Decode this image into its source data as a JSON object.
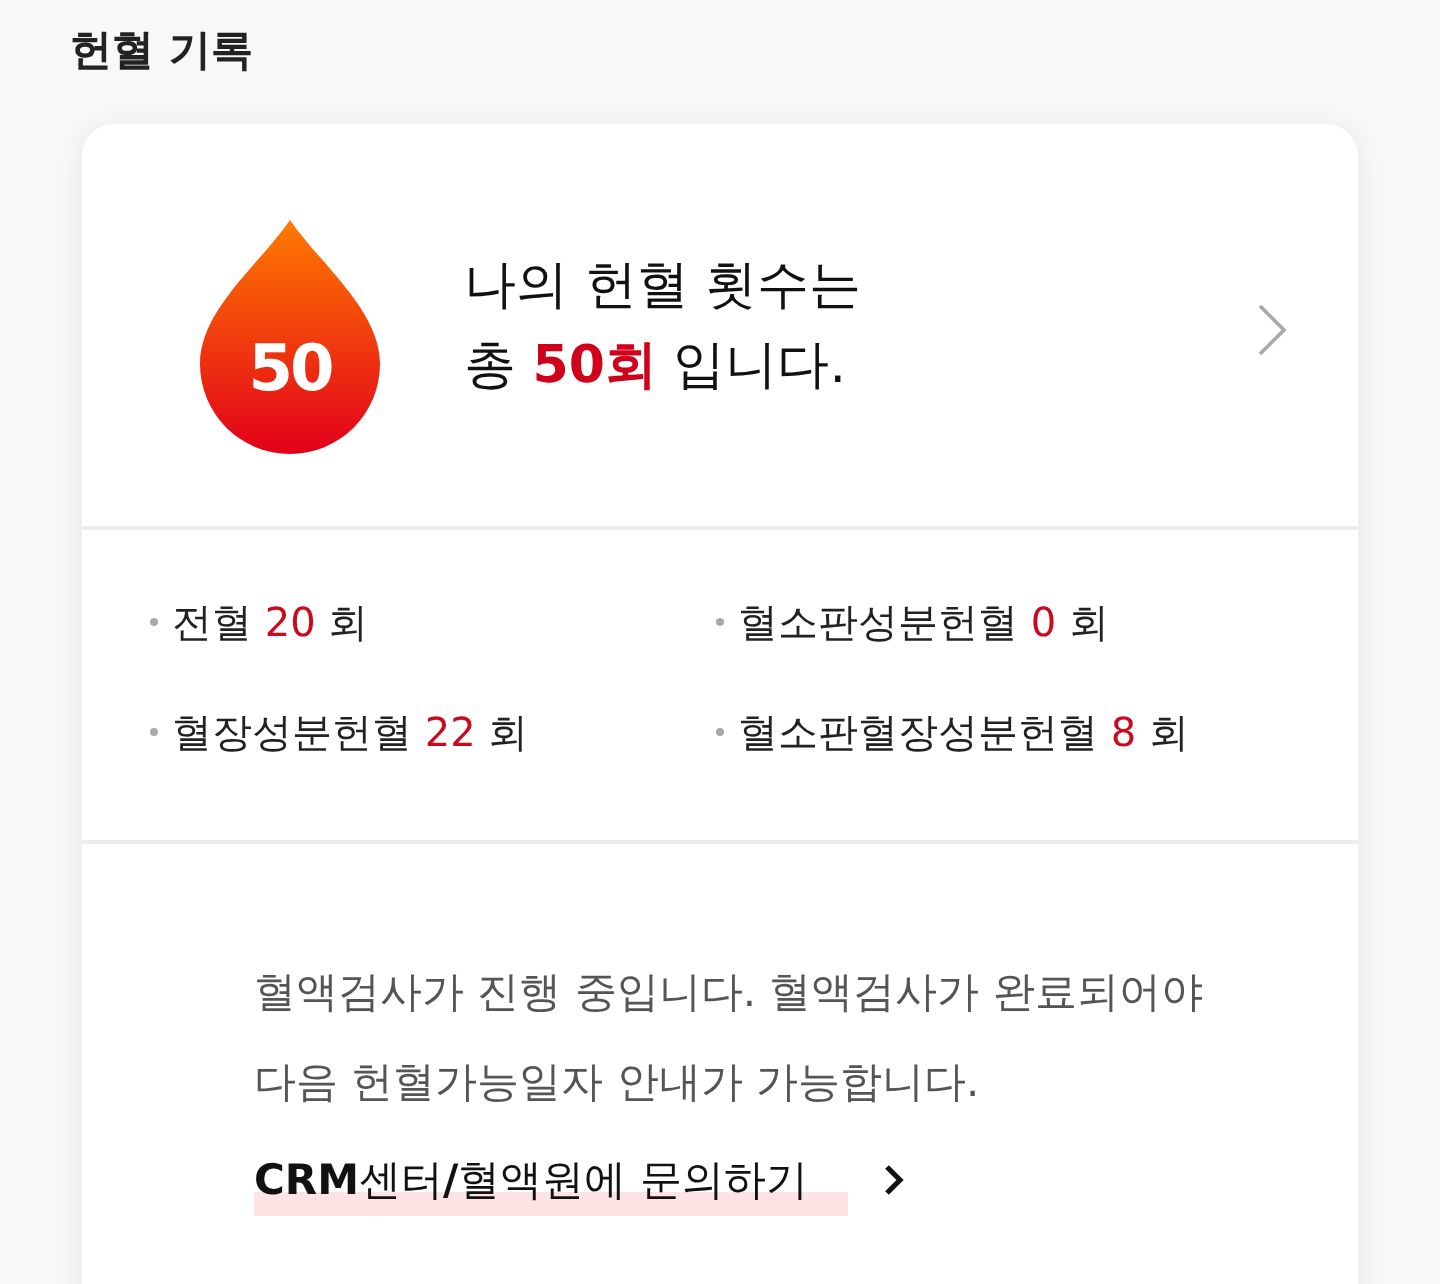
{
  "section_title": "헌혈 기록",
  "summary": {
    "badge_count": "50",
    "lines": [
      "나의 헌혈 횟수는",
      "총 **50회** 입니다."
    ]
  },
  "stats": [
    {
      "label": "전혈",
      "count": "20",
      "unit": "회"
    },
    {
      "label": "혈소판성분헌혈",
      "count": "0",
      "unit": "회"
    },
    {
      "label": "혈장성분헌혈",
      "count": "22",
      "unit": "회"
    },
    {
      "label": "혈소판혈장성분헌혈",
      "count": "8",
      "unit": "회"
    }
  ],
  "notice": {
    "lines": [
      "혈액검사가 진행 중입니다. 혈액검사가 완료되어야",
      "다음 헌혈가능일자 안내가 가능합니다."
    ],
    "link": "**CRM**센터**/**혈액원에 문의하기"
  }
}
